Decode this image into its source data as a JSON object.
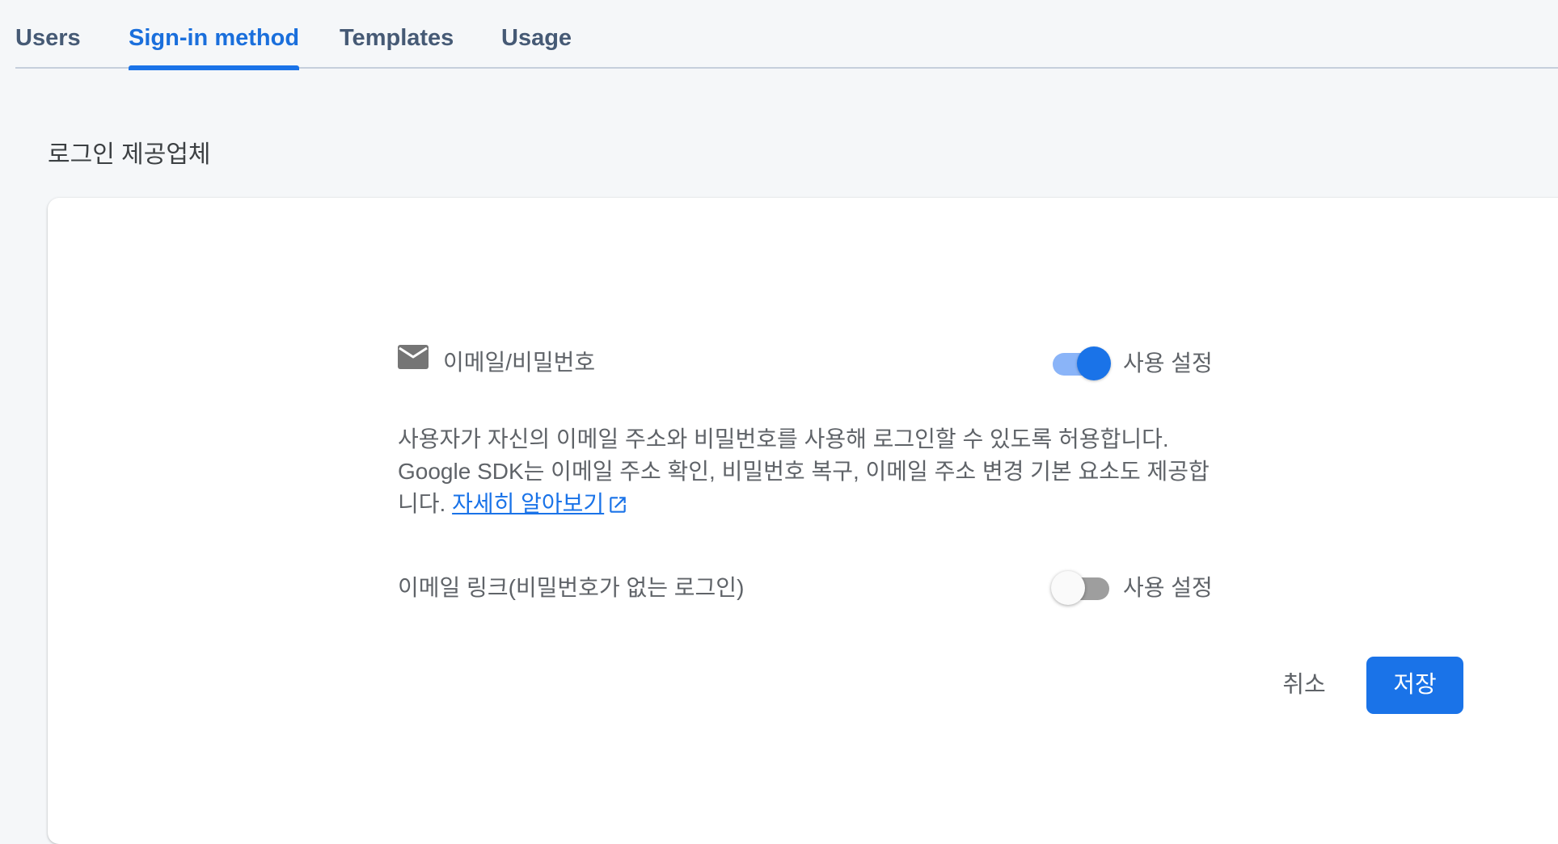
{
  "tabs": [
    {
      "label": "Users",
      "active": false
    },
    {
      "label": "Sign-in method",
      "active": true
    },
    {
      "label": "Templates",
      "active": false
    },
    {
      "label": "Usage",
      "active": false
    }
  ],
  "section": {
    "title": "로그인 제공업체"
  },
  "provider": {
    "icon": "mail-icon",
    "label": "이메일/비밀번호",
    "enabled": true,
    "toggle_label": "사용 설정",
    "description": "사용자가 자신의 이메일 주소와 비밀번호를 사용해 로그인할 수 있도록 허용합니다. Google SDK는 이메일 주소 확인, 비밀번호 복구, 이메일 주소 변경 기본 요소도 제공합니다.",
    "learn_more": "자세히 알아보기",
    "email_link": {
      "label": "이메일 링크(비밀번호가 없는 로그인)",
      "enabled": false,
      "toggle_label": "사용 설정"
    }
  },
  "actions": {
    "cancel": "취소",
    "save": "저장"
  },
  "colors": {
    "accent": "#1a73e8",
    "toggle_on_track": "#8ab4f8",
    "toggle_off_track": "#9e9e9e",
    "tab_text": "#465a75",
    "background": "#f5f7f9"
  }
}
